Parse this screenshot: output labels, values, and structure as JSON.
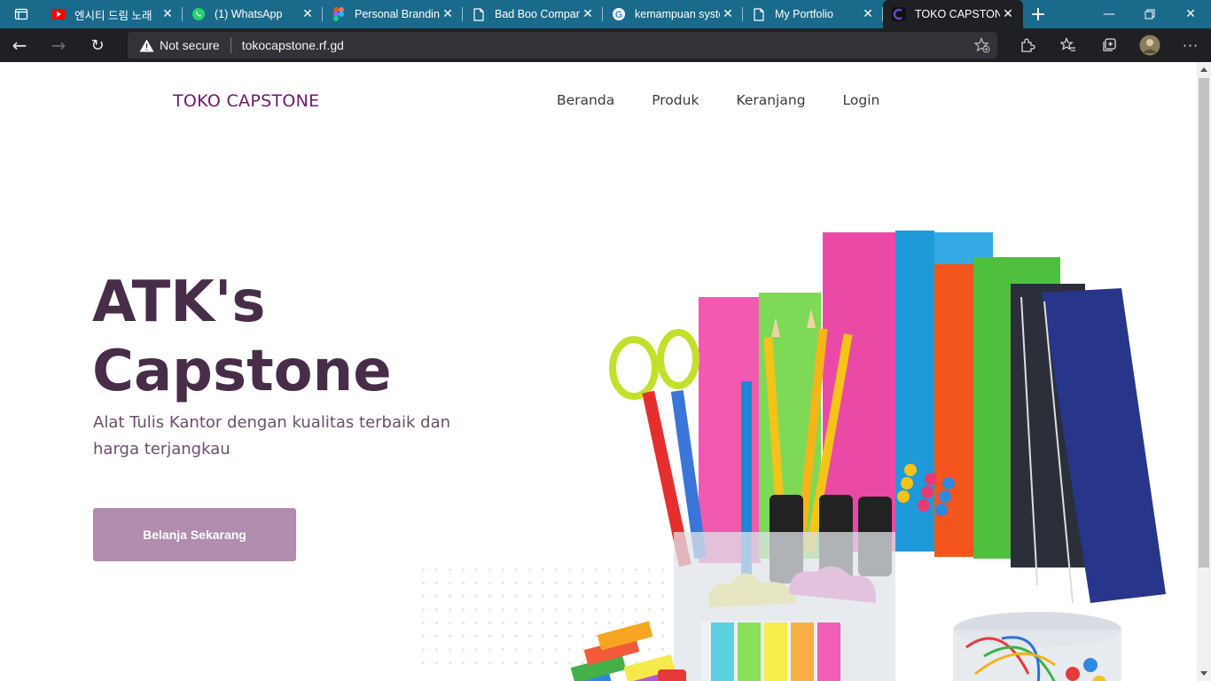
{
  "browser": {
    "tabs": [
      {
        "title": "엔시티 드림 노래",
        "icon": "youtube-icon"
      },
      {
        "title": "(1) WhatsApp",
        "icon": "whatsapp-icon"
      },
      {
        "title": "Personal Branding",
        "icon": "figma-icon"
      },
      {
        "title": "Bad Boo Company",
        "icon": "document-icon"
      },
      {
        "title": "kemampuan system",
        "icon": "google-icon"
      },
      {
        "title": "My Portfolio",
        "icon": "document-icon"
      },
      {
        "title": "TOKO CAPSTONE",
        "icon": "site-icon",
        "active": true
      }
    ],
    "security": "Not secure",
    "url": "tokocapstone.rf.gd",
    "colors": {
      "tabbar": "#1a6a8c",
      "toolbar": "#1f2024"
    }
  },
  "site": {
    "brand": "TOKO CAPSTONE",
    "nav": [
      "Beranda",
      "Produk",
      "Keranjang",
      "Login"
    ],
    "hero": {
      "title_line1": "ATK's",
      "title_line2": "Capstone",
      "subtitle": "Alat Tulis Kantor dengan kualitas terbaik dan harga terjangkau",
      "cta": "Belanja Sekarang"
    },
    "colors": {
      "brand": "#6b1a6e",
      "title": "#472d48",
      "subtitle": "#6c4d6d",
      "cta": "#b08dae"
    }
  }
}
